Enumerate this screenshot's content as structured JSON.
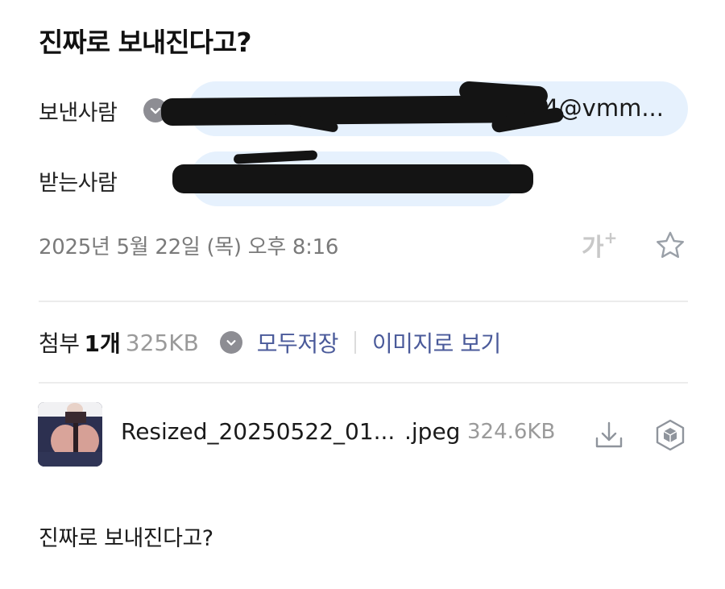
{
  "mail": {
    "subject": "진짜로 보내진다고?",
    "sender_label": "보낸사람",
    "sender_visible_text": "4@vmm...",
    "recipient_label": "받는사람",
    "date": "2025년 5월 22일 (목) 오후 8:16",
    "font_size_button": "가",
    "font_size_plus": "+",
    "body": "진짜로 보내진다고?"
  },
  "attachments": {
    "title": "첨부",
    "count": "1개",
    "total_size": "325KB",
    "save_all_label": "모두저장",
    "view_as_images_label": "이미지로 보기",
    "files": [
      {
        "name": "Resized_20250522_01...",
        "ext": ".jpeg",
        "size": "324.6KB"
      }
    ]
  },
  "colors": {
    "chip_bg": "#e6f1fd",
    "link": "#4a5a9a",
    "muted": "#9a9a9a",
    "icon_gray": "#8d8d93"
  },
  "icons": [
    "chevron-down-icon",
    "star-icon",
    "download-icon",
    "cube-viewer-icon"
  ]
}
